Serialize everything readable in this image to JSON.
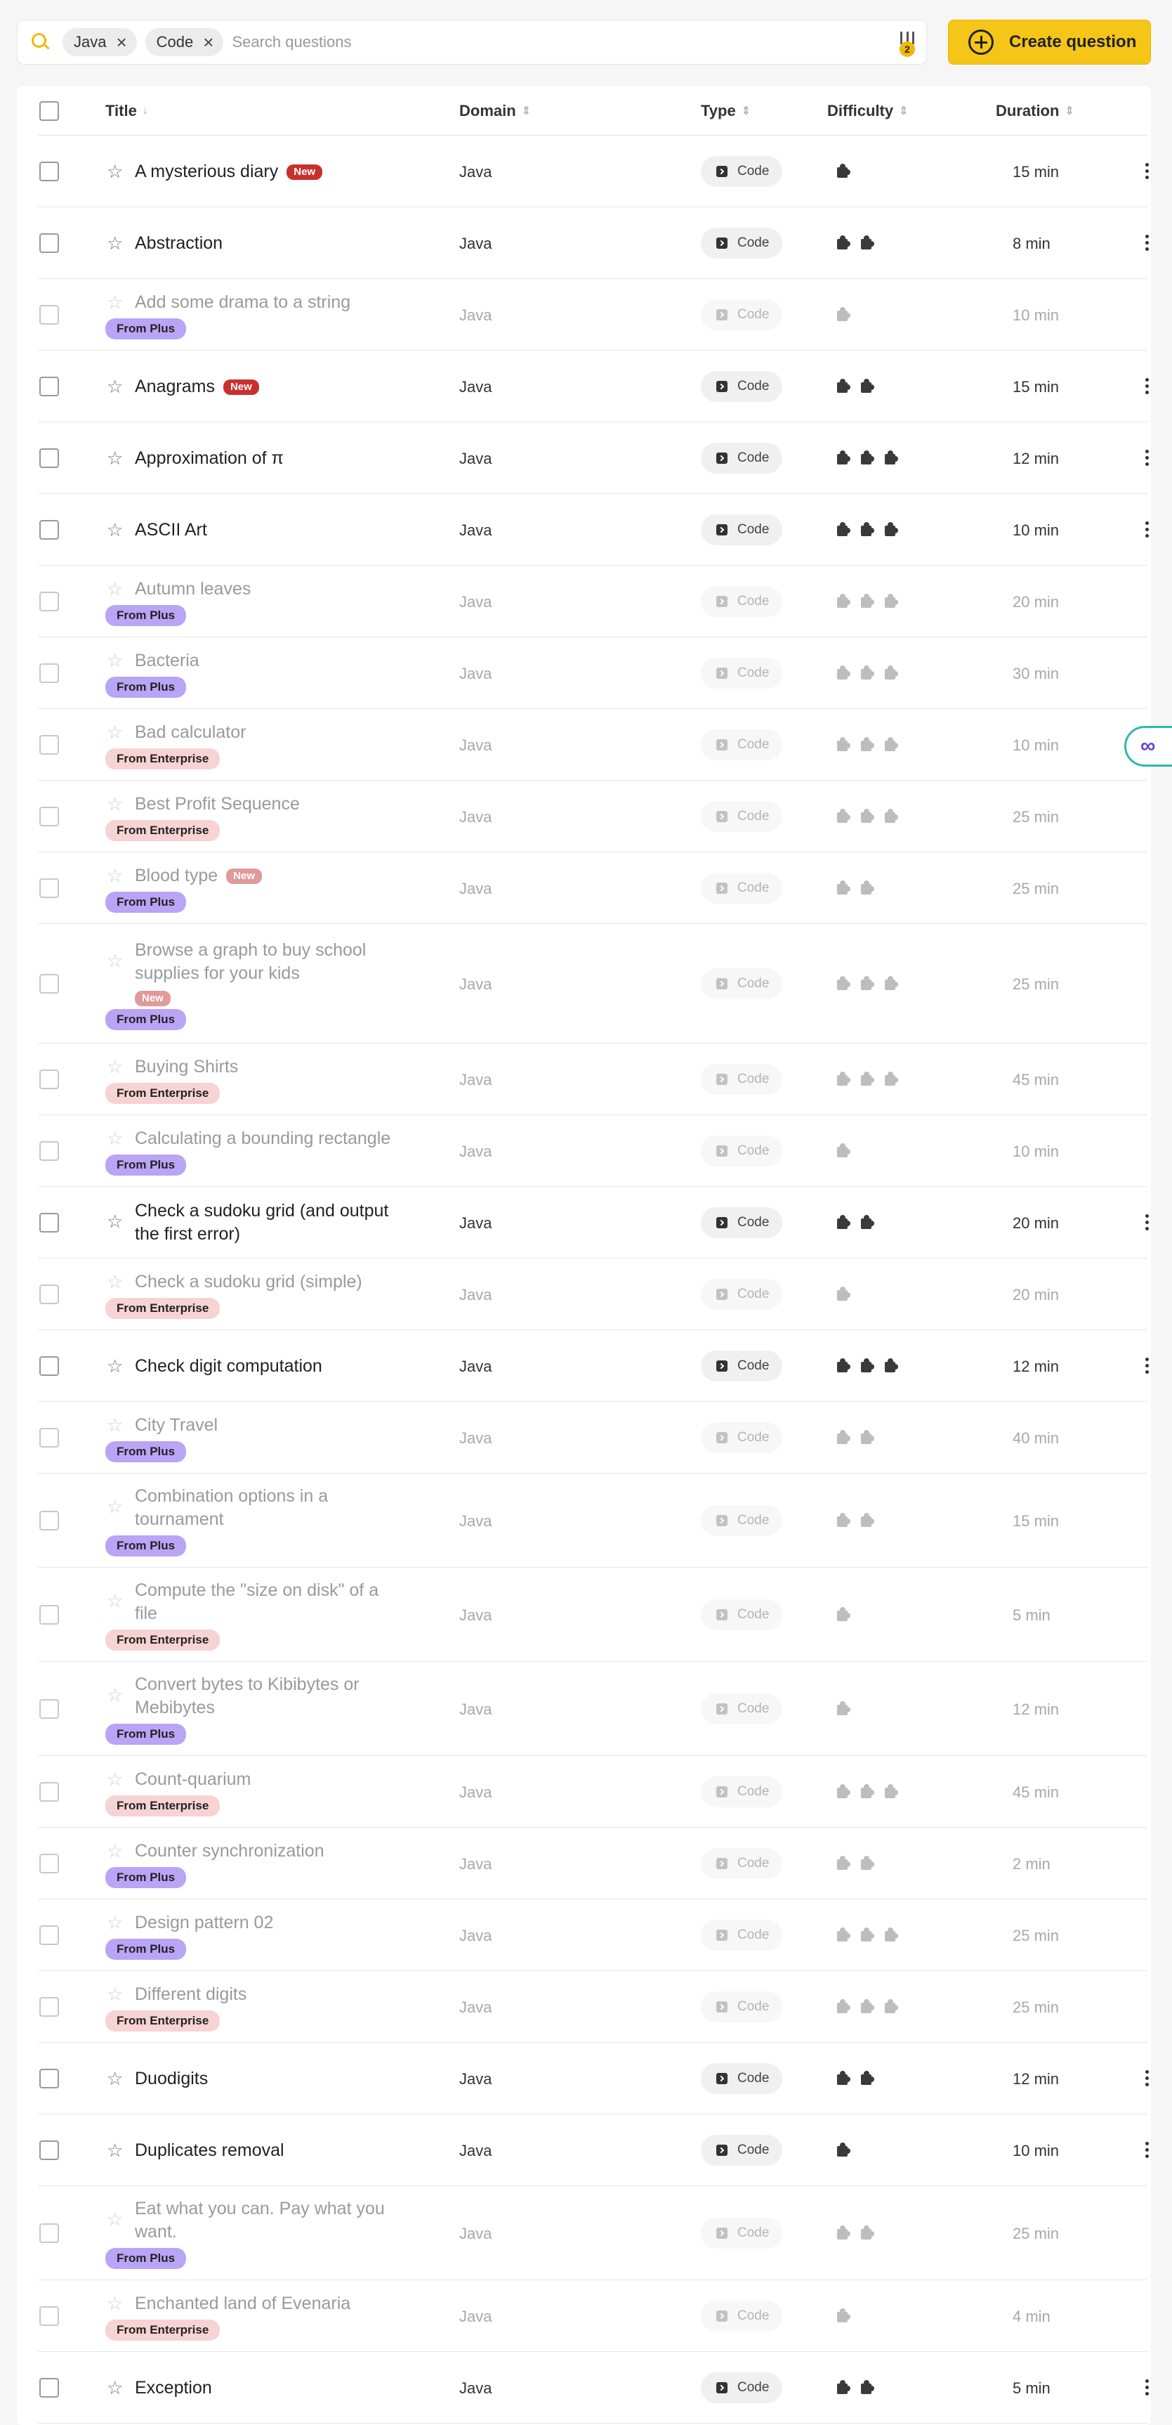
{
  "search": {
    "chips": [
      {
        "label": "Java"
      },
      {
        "label": "Code"
      }
    ],
    "placeholder": "Search questions",
    "filter_count": "2"
  },
  "create_button": {
    "label": "Create question"
  },
  "columns": {
    "title": "Title",
    "domain": "Domain",
    "type": "Type",
    "difficulty": "Difficulty",
    "duration": "Duration"
  },
  "rows": [
    {
      "title": "A mysterious diary",
      "new": "New",
      "plan": "",
      "domain": "Java",
      "type": "Code",
      "difficulty": 1,
      "duration": "15 min",
      "locked": false
    },
    {
      "title": "Abstraction",
      "new": "",
      "plan": "",
      "domain": "Java",
      "type": "Code",
      "difficulty": 2,
      "duration": "8 min",
      "locked": false
    },
    {
      "title": "Add some drama to a string",
      "new": "",
      "plan": "From Plus",
      "domain": "Java",
      "type": "Code",
      "difficulty": 1,
      "duration": "10 min",
      "locked": true
    },
    {
      "title": "Anagrams",
      "new": "New",
      "plan": "",
      "domain": "Java",
      "type": "Code",
      "difficulty": 2,
      "duration": "15 min",
      "locked": false
    },
    {
      "title": "Approximation of π",
      "new": "",
      "plan": "",
      "domain": "Java",
      "type": "Code",
      "difficulty": 3,
      "duration": "12 min",
      "locked": false
    },
    {
      "title": "ASCII Art",
      "new": "",
      "plan": "",
      "domain": "Java",
      "type": "Code",
      "difficulty": 3,
      "duration": "10 min",
      "locked": false
    },
    {
      "title": "Autumn leaves",
      "new": "",
      "plan": "From Plus",
      "domain": "Java",
      "type": "Code",
      "difficulty": 3,
      "duration": "20 min",
      "locked": true
    },
    {
      "title": "Bacteria",
      "new": "",
      "plan": "From Plus",
      "domain": "Java",
      "type": "Code",
      "difficulty": 3,
      "duration": "30 min",
      "locked": true
    },
    {
      "title": "Bad calculator",
      "new": "",
      "plan": "From Enterprise",
      "domain": "Java",
      "type": "Code",
      "difficulty": 3,
      "duration": "10 min",
      "locked": true
    },
    {
      "title": "Best Profit Sequence",
      "new": "",
      "plan": "From Enterprise",
      "domain": "Java",
      "type": "Code",
      "difficulty": 3,
      "duration": "25 min",
      "locked": true
    },
    {
      "title": "Blood type",
      "new": "New",
      "plan": "From Plus",
      "domain": "Java",
      "type": "Code",
      "difficulty": 2,
      "duration": "25 min",
      "locked": true
    },
    {
      "title_lines": [
        "Browse a graph to buy school",
        "supplies for your kids"
      ],
      "new": "New",
      "plan": "From Plus",
      "domain": "Java",
      "type": "Code",
      "difficulty": 3,
      "duration": "25 min",
      "locked": true
    },
    {
      "title": "Buying Shirts",
      "new": "",
      "plan": "From Enterprise",
      "domain": "Java",
      "type": "Code",
      "difficulty": 3,
      "duration": "45 min",
      "locked": true
    },
    {
      "title": "Calculating a bounding rectangle",
      "new": "",
      "plan": "From Plus",
      "domain": "Java",
      "type": "Code",
      "difficulty": 1,
      "duration": "10 min",
      "locked": true
    },
    {
      "title_lines": [
        "Check a sudoku grid (and output",
        "the first error)"
      ],
      "new": "",
      "plan": "",
      "domain": "Java",
      "type": "Code",
      "difficulty": 2,
      "duration": "20 min",
      "locked": false
    },
    {
      "title": "Check a sudoku grid (simple)",
      "new": "",
      "plan": "From Enterprise",
      "domain": "Java",
      "type": "Code",
      "difficulty": 1,
      "duration": "20 min",
      "locked": true
    },
    {
      "title": "Check digit computation",
      "new": "",
      "plan": "",
      "domain": "Java",
      "type": "Code",
      "difficulty": 3,
      "duration": "12 min",
      "locked": false
    },
    {
      "title": "City Travel",
      "new": "",
      "plan": "From Plus",
      "domain": "Java",
      "type": "Code",
      "difficulty": 2,
      "duration": "40 min",
      "locked": true
    },
    {
      "title_lines": [
        "Combination options in a",
        "tournament"
      ],
      "new": "",
      "plan": "From Plus",
      "domain": "Java",
      "type": "Code",
      "difficulty": 2,
      "duration": "15 min",
      "locked": true
    },
    {
      "title_lines": [
        "Compute the \"size on disk\" of a",
        "file"
      ],
      "new": "",
      "plan": "From Enterprise",
      "domain": "Java",
      "type": "Code",
      "difficulty": 1,
      "duration": "5 min",
      "locked": true
    },
    {
      "title_lines": [
        "Convert bytes to Kibibytes or",
        "Mebibytes"
      ],
      "new": "",
      "plan": "From Plus",
      "domain": "Java",
      "type": "Code",
      "difficulty": 1,
      "duration": "12 min",
      "locked": true
    },
    {
      "title": "Count-quarium",
      "new": "",
      "plan": "From Enterprise",
      "domain": "Java",
      "type": "Code",
      "difficulty": 3,
      "duration": "45 min",
      "locked": true
    },
    {
      "title": "Counter synchronization",
      "new": "",
      "plan": "From Plus",
      "domain": "Java",
      "type": "Code",
      "difficulty": 2,
      "duration": "2 min",
      "locked": true
    },
    {
      "title": "Design pattern 02",
      "new": "",
      "plan": "From Plus",
      "domain": "Java",
      "type": "Code",
      "difficulty": 3,
      "duration": "25 min",
      "locked": true
    },
    {
      "title": "Different digits",
      "new": "",
      "plan": "From Enterprise",
      "domain": "Java",
      "type": "Code",
      "difficulty": 3,
      "duration": "25 min",
      "locked": true
    },
    {
      "title": "Duodigits",
      "new": "",
      "plan": "",
      "domain": "Java",
      "type": "Code",
      "difficulty": 2,
      "duration": "12 min",
      "locked": false
    },
    {
      "title": "Duplicates removal",
      "new": "",
      "plan": "",
      "domain": "Java",
      "type": "Code",
      "difficulty": 1,
      "duration": "10 min",
      "locked": false
    },
    {
      "title_lines": [
        "Eat what you can. Pay what you",
        "want."
      ],
      "new": "",
      "plan": "From Plus",
      "domain": "Java",
      "type": "Code",
      "difficulty": 2,
      "duration": "25 min",
      "locked": true
    },
    {
      "title": "Enchanted land of Evenaria",
      "new": "",
      "plan": "From Enterprise",
      "domain": "Java",
      "type": "Code",
      "difficulty": 1,
      "duration": "4 min",
      "locked": true
    },
    {
      "title": "Exception",
      "new": "",
      "plan": "",
      "domain": "Java",
      "type": "Code",
      "difficulty": 2,
      "duration": "5 min",
      "locked": false
    }
  ],
  "side_tab": {
    "glyph": "∞"
  }
}
